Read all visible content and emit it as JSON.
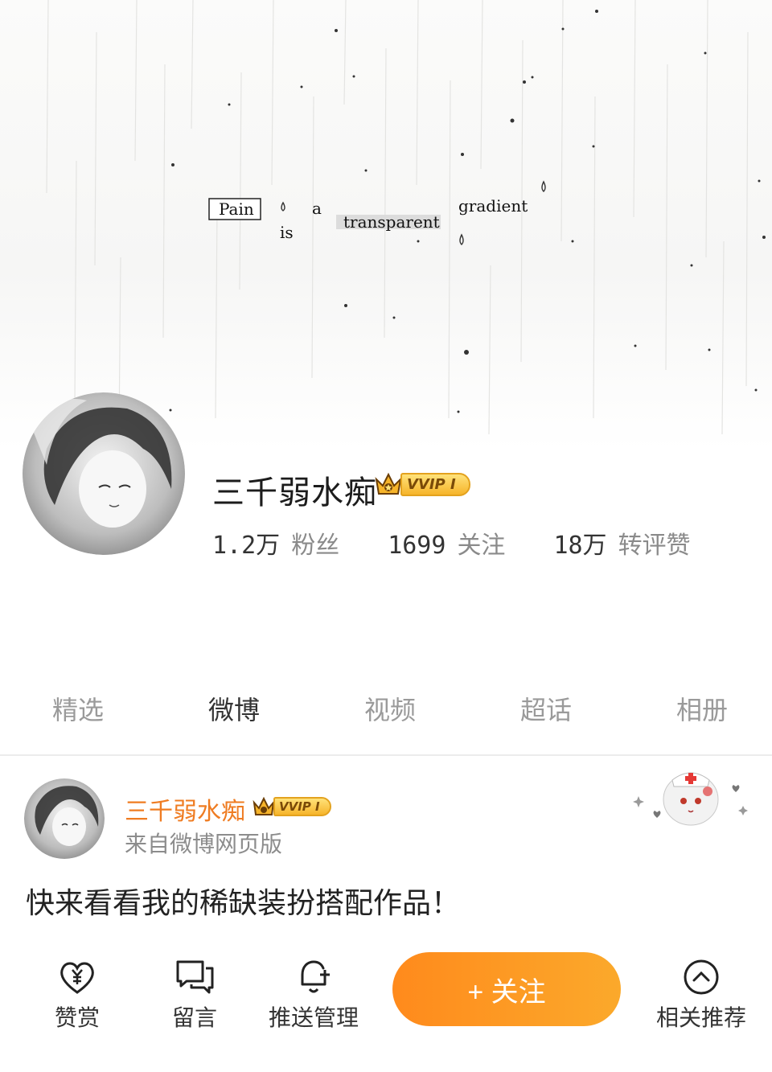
{
  "banner": {
    "words": [
      "Pain",
      "is",
      "a",
      "transparent",
      "gradient"
    ]
  },
  "profile": {
    "name": "三千弱水痴",
    "vip_label": "VVIP I",
    "stats": [
      {
        "value": "1.2万",
        "label": "粉丝"
      },
      {
        "value": "1699",
        "label": "关注"
      },
      {
        "value": "18万",
        "label": "转评赞"
      }
    ]
  },
  "tabs": [
    {
      "label": "精选",
      "active": false
    },
    {
      "label": "微博",
      "active": true
    },
    {
      "label": "视频",
      "active": false
    },
    {
      "label": "超话",
      "active": false
    },
    {
      "label": "相册",
      "active": false
    }
  ],
  "post": {
    "author": "三千弱水痴",
    "vip_label": "VVIP I",
    "source": "来自微博网页版",
    "text": "快来看看我的稀缺装扮搭配作品！"
  },
  "bottom_bar": {
    "reward": "赞赏",
    "message": "留言",
    "push": "推送管理",
    "follow": "+ 关注",
    "related": "相关推荐"
  },
  "colors": {
    "accent_orange": "#ef7c22",
    "follow_gradient_start": "#ff8a1c",
    "follow_gradient_end": "#fba92b",
    "vip_gold": "#f6b42a"
  }
}
